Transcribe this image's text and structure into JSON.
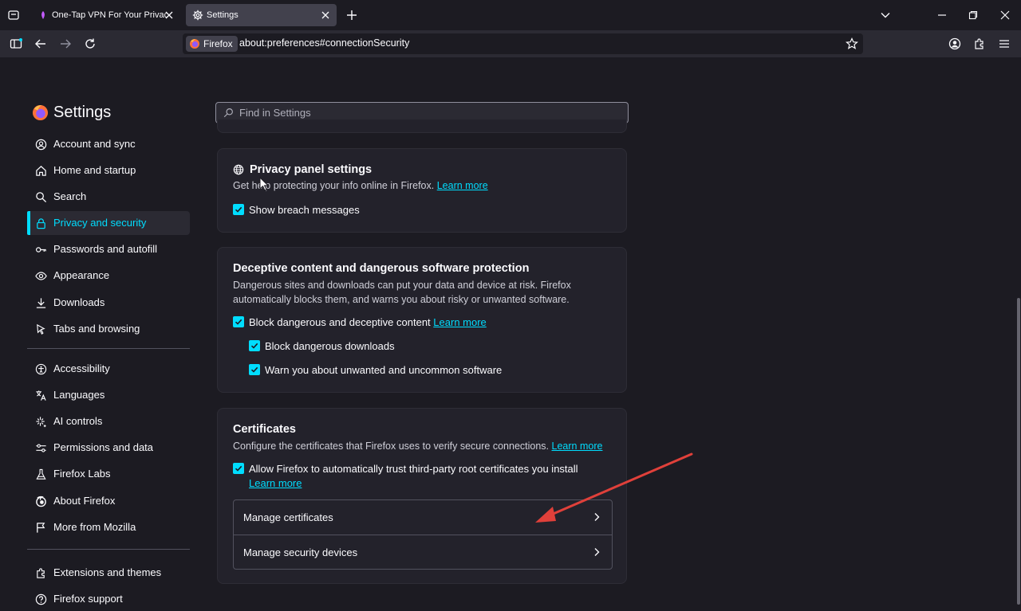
{
  "tabs": [
    {
      "title": "One-Tap VPN For Your Privacy & ",
      "icon": "vpn-extension-icon"
    },
    {
      "title": "Settings",
      "icon": "gear-icon"
    }
  ],
  "navbar": {
    "identity_label": "Firefox",
    "url": "about:preferences#connectionSecurity"
  },
  "sidebar": {
    "title": "Settings",
    "items": [
      {
        "label": "Account and sync",
        "icon": "account-icon"
      },
      {
        "label": "Home and startup",
        "icon": "home-icon"
      },
      {
        "label": "Search",
        "icon": "search-icon"
      },
      {
        "label": "Privacy and security",
        "icon": "lock-icon"
      },
      {
        "label": "Passwords and autofill",
        "icon": "key-icon"
      },
      {
        "label": "Appearance",
        "icon": "eye-icon"
      },
      {
        "label": "Downloads",
        "icon": "download-icon"
      },
      {
        "label": "Tabs and browsing",
        "icon": "cursor-icon"
      },
      {
        "label": "Accessibility",
        "icon": "accessibility-icon"
      },
      {
        "label": "Languages",
        "icon": "translate-icon"
      },
      {
        "label": "AI controls",
        "icon": "sparkle-icon"
      },
      {
        "label": "Permissions and data",
        "icon": "sliders-icon"
      },
      {
        "label": "Firefox Labs",
        "icon": "flask-icon"
      },
      {
        "label": "About Firefox",
        "icon": "firefox-icon"
      },
      {
        "label": "More from Mozilla",
        "icon": "mozilla-icon"
      },
      {
        "label": "Extensions and themes",
        "icon": "puzzle-icon"
      },
      {
        "label": "Firefox support",
        "icon": "help-icon"
      }
    ]
  },
  "search": {
    "placeholder": "Find in Settings"
  },
  "privacy_panel": {
    "title": "Privacy panel settings",
    "description": "Get help protecting your info online in Firefox.",
    "learn_more": "Learn more",
    "checkbox_breach": "Show breach messages"
  },
  "deceptive": {
    "title": "Deceptive content and dangerous software protection",
    "description_line1": "Dangerous sites and downloads can put your data and device at risk. Firefox",
    "description_line2": "automatically blocks them, and warns you about risky or unwanted software.",
    "checkbox_block": "Block dangerous and deceptive content",
    "learn_more": "Learn more",
    "checkbox_downloads": "Block dangerous downloads",
    "checkbox_unwanted": "Warn you about unwanted and uncommon software"
  },
  "certificates": {
    "title": "Certificates",
    "description": "Configure the certificates that Firefox uses to verify secure connections.",
    "learn_more": "Learn more",
    "checkbox_trust": "Allow Firefox to automatically trust third-party root certificates you install",
    "trust_learn_more": "Learn more",
    "manage_certificates": "Manage certificates",
    "manage_devices": "Manage security devices"
  },
  "colors": {
    "accent": "#00ddff",
    "annotation_arrow": "#e0403a",
    "background": "#1c1b22"
  }
}
